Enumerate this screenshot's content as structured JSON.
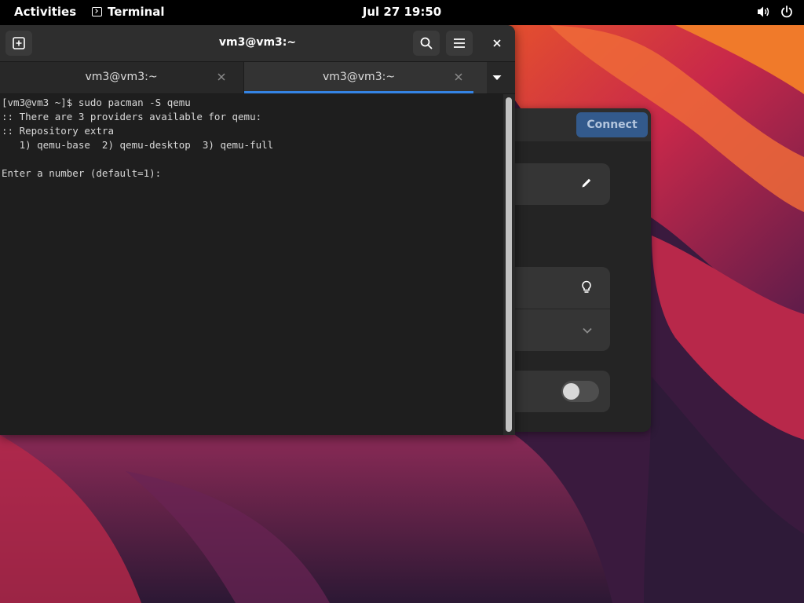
{
  "topbar": {
    "activities": "Activities",
    "app_name": "Terminal",
    "clock": "Jul 27  19:50",
    "icons": [
      "terminal-app-icon",
      "volume-icon",
      "power-icon"
    ]
  },
  "terminal": {
    "title": "vm3@vm3:~",
    "tabs": [
      {
        "label": "vm3@vm3:~",
        "active": false
      },
      {
        "label": "vm3@vm3:~",
        "active": true
      }
    ],
    "lines": [
      "[vm3@vm3 ~]$ sudo pacman -S qemu",
      ":: There are 3 providers available for qemu:",
      ":: Repository extra",
      "   1) qemu-base  2) qemu-desktop  3) qemu-full",
      "",
      "Enter a number (default=1): "
    ],
    "accent_color": "#3584e4"
  },
  "background_dialog": {
    "connect_label": "Connect",
    "icons": [
      "pencil-icon",
      "lightbulb-icon",
      "chevron-down-icon"
    ],
    "toggle_on": false
  }
}
